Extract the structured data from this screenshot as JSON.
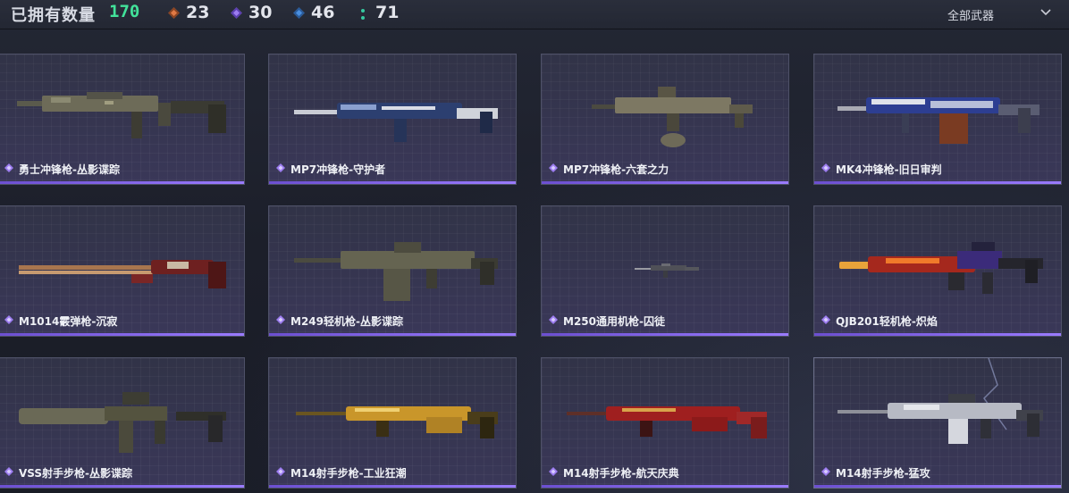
{
  "header": {
    "owned_label": "已拥有数量",
    "owned_count": "170",
    "stats": [
      {
        "name": "orange-rarity",
        "value": "23",
        "color": "#e07a45"
      },
      {
        "name": "purple-rarity",
        "value": "30",
        "color": "#9c7cf0"
      },
      {
        "name": "blue-rarity",
        "value": "46",
        "color": "#4a8fe0"
      },
      {
        "name": "green-rarity",
        "value": "71",
        "color": "#36c9a0"
      }
    ],
    "filter_label": "全部武器"
  },
  "weapons": [
    {
      "name": "勇士冲锋枪-丛影谍踪",
      "skin": "camo-gray"
    },
    {
      "name": "MP7冲锋枪-守护者",
      "skin": "blue-silver"
    },
    {
      "name": "MP7冲锋枪-六套之力",
      "skin": "camo-tan"
    },
    {
      "name": "MK4冲锋枪-旧日审判",
      "skin": "chrome-blue"
    },
    {
      "name": "M1014霰弹枪-沉寂",
      "skin": "maroon"
    },
    {
      "name": "M249轻机枪-丛影谍踪",
      "skin": "camo-gray"
    },
    {
      "name": "M250通用机枪-囚徒",
      "skin": "gray-small"
    },
    {
      "name": "QJB201轻机枪-炽焰",
      "skin": "flame"
    },
    {
      "name": "VSS射手步枪-丛影谍踪",
      "skin": "camo-gray"
    },
    {
      "name": "M14射手步枪-工业狂潮",
      "skin": "gold"
    },
    {
      "name": "M14射手步枪-航天庆典",
      "skin": "red-gold"
    },
    {
      "name": "M14射手步枪-猛攻",
      "skin": "white-black"
    }
  ],
  "colors": {
    "accent_count": "#42e29a",
    "rarity_purple": "#9c7cf0"
  },
  "icons": {
    "filter": "chevron-down-icon",
    "rarity": "diamond-icon"
  }
}
